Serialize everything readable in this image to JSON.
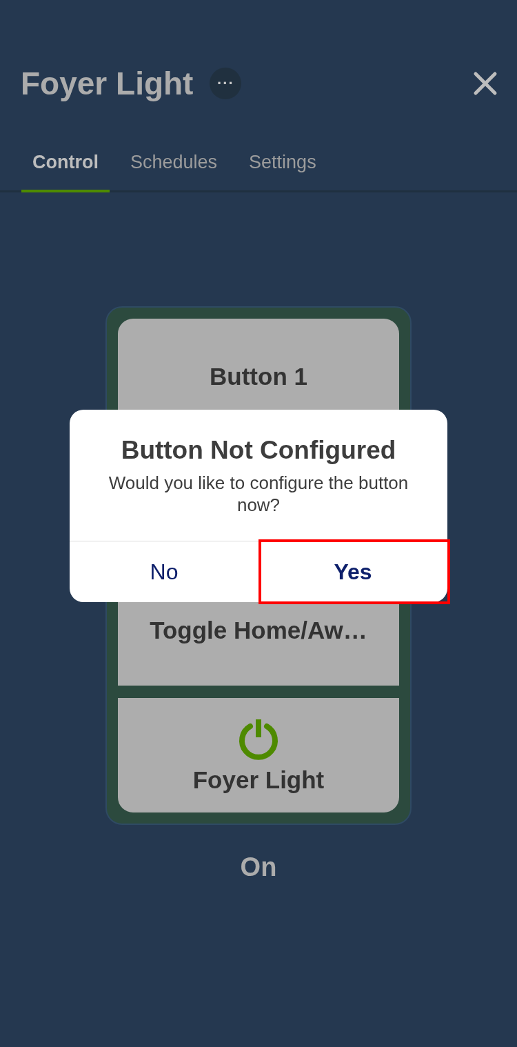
{
  "header": {
    "title": "Foyer Light",
    "more_label": "···"
  },
  "tabs": [
    {
      "label": "Control",
      "selected": true
    },
    {
      "label": "Schedules",
      "selected": false
    },
    {
      "label": "Settings",
      "selected": false
    }
  ],
  "device": {
    "tiles": [
      {
        "kind": "text",
        "label": "Button 1"
      },
      {
        "kind": "text",
        "label": "Toggle Home/Aw…"
      },
      {
        "kind": "power",
        "label": "Foyer Light",
        "on": true
      }
    ],
    "status": "On"
  },
  "dialog": {
    "title": "Button Not Configured",
    "message": "Would you like to configure the button now?",
    "buttons": [
      {
        "label": "No",
        "kind": "plain",
        "highlighted": false
      },
      {
        "label": "Yes",
        "kind": "primary",
        "highlighted": true
      }
    ]
  }
}
